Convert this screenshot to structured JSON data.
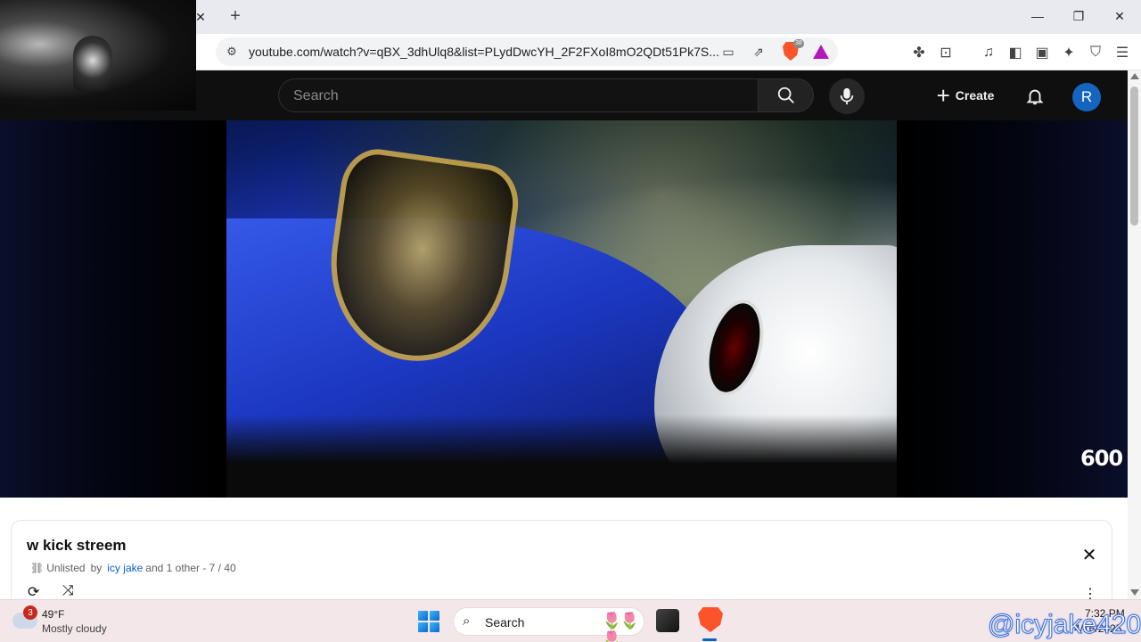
{
  "browser": {
    "url": "youtube.com/watch?v=qBX_3dhUlq8&list=PLydDwcYH_2F2FXoI8mO2QDt51Pk7S...",
    "brave_shield_count": "38",
    "close_tab_glyph": "✕",
    "new_tab_glyph": "+",
    "window_controls": {
      "minimize": "—",
      "maximize": "❐",
      "close": "✕"
    }
  },
  "youtube": {
    "search_placeholder": "Search",
    "create_label": "Create",
    "avatar_letter": "R"
  },
  "video": {
    "watermark": "600"
  },
  "playlist": {
    "title": "w kick streem",
    "visibility": "Unlisted",
    "by_prefix": "by",
    "author": "icy jake",
    "others": "and 1 other - 7 / 40"
  },
  "taskbar": {
    "weather_badge": "3",
    "temperature": "49°F",
    "condition": "Mostly cloudy",
    "search_label": "Search",
    "time": "7:32 PM",
    "date": "4/16/2025"
  },
  "overlay": {
    "handle": "@icyjake420"
  },
  "colors": {
    "youtube_bg": "#0f0f0f",
    "link_blue": "#065fd4",
    "avatar_blue": "#1565c0",
    "brave_orange": "#fb542b",
    "taskbar_bg": "#f4e7ea"
  }
}
